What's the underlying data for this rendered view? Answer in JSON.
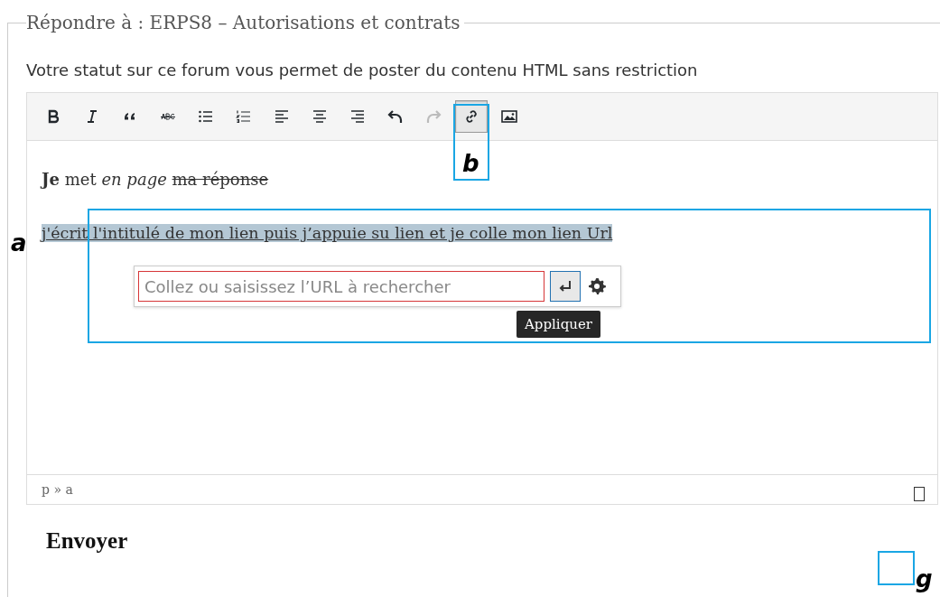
{
  "form": {
    "legend": "Répondre à : ERPS8 – Autorisations et contrats",
    "notice": "Votre statut sur ce forum vous permet de poster du contenu HTML sans restriction"
  },
  "toolbar": [
    {
      "kind": "bold",
      "active": false,
      "disabled": false
    },
    {
      "kind": "italic",
      "active": false,
      "disabled": false
    },
    {
      "kind": "quote",
      "active": false,
      "disabled": false
    },
    {
      "kind": "strike",
      "active": false,
      "disabled": false
    },
    {
      "kind": "bullets",
      "active": false,
      "disabled": false
    },
    {
      "kind": "numbers",
      "active": false,
      "disabled": false
    },
    {
      "kind": "align-left",
      "active": false,
      "disabled": false
    },
    {
      "kind": "align-center",
      "active": false,
      "disabled": false
    },
    {
      "kind": "align-right",
      "active": false,
      "disabled": false
    },
    {
      "kind": "undo",
      "active": false,
      "disabled": false
    },
    {
      "kind": "redo",
      "active": false,
      "disabled": true
    },
    {
      "kind": "link",
      "active": true,
      "disabled": false
    },
    {
      "kind": "image",
      "active": false,
      "disabled": false
    }
  ],
  "content": {
    "paragraph": [
      {
        "kind": "bold",
        "text": "Je"
      },
      {
        "kind": "plain",
        "text": "met"
      },
      {
        "kind": "italic",
        "text": "en page"
      },
      {
        "kind": "strike",
        "text": "ma réponse"
      }
    ],
    "link_text": "j'écrit l'intitulé de mon lien puis j’appuie su lien et je colle mon lien Url",
    "link_selected": true
  },
  "link_popup": {
    "placeholder": "Collez ou saisissez l’URL à rechercher",
    "tooltip": "Appliquer"
  },
  "status_bar": {
    "path": "p » a"
  },
  "submit": "Envoyer",
  "annotations": [
    {
      "label": "a"
    },
    {
      "label": "b"
    },
    {
      "label": "g"
    }
  ]
}
